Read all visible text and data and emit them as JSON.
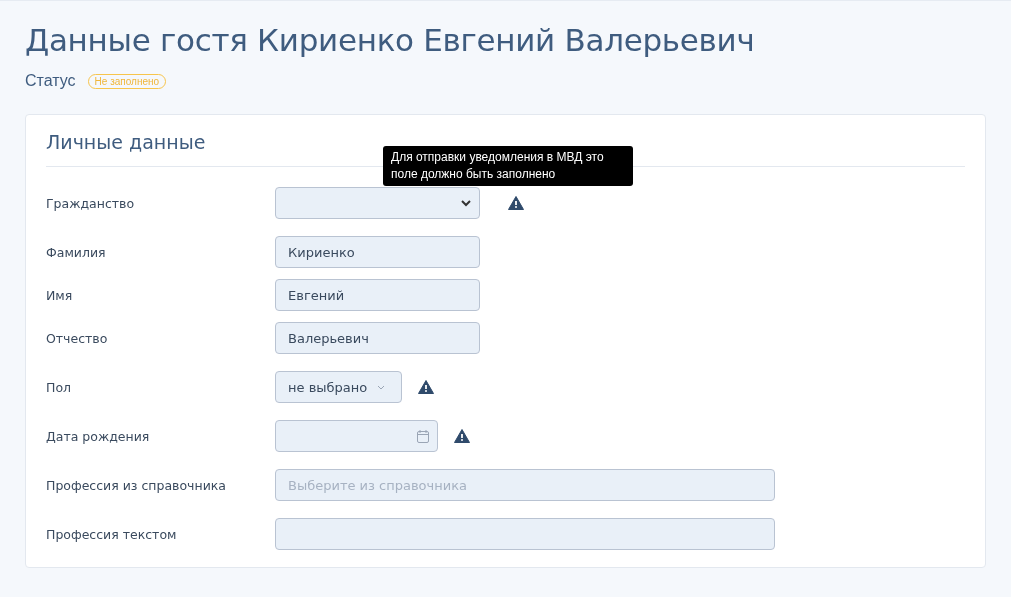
{
  "title": "Данные гостя Кириенко Евгений Валерьевич",
  "status": {
    "label": "Статус",
    "badge": "Не заполнено"
  },
  "section": {
    "title": "Личные данные"
  },
  "fields": [
    {
      "label": "Гражданство",
      "kind": "select",
      "warning": true,
      "tooltip": "Для отправки уведомления в МВД это поле должно быть заполнено"
    },
    {
      "label": "Фамилия",
      "kind": "text",
      "value": "Кириенко",
      "warning": false
    },
    {
      "label": "Имя",
      "kind": "text",
      "value": "Евгений",
      "warning": false
    },
    {
      "label": "Отчество",
      "kind": "text",
      "value": "Валерьевич",
      "warning": false
    },
    {
      "label": "Пол",
      "kind": "dropdown",
      "value": "не выбрано",
      "warning": true
    },
    {
      "label": "Дата рождения",
      "kind": "date",
      "warning": true
    },
    {
      "label": "Профессия из справочника",
      "kind": "lookup",
      "placeholder": "Выберите из справочника",
      "warning": false
    },
    {
      "label": "Профессия текстом",
      "kind": "wide",
      "warning": false
    }
  ]
}
